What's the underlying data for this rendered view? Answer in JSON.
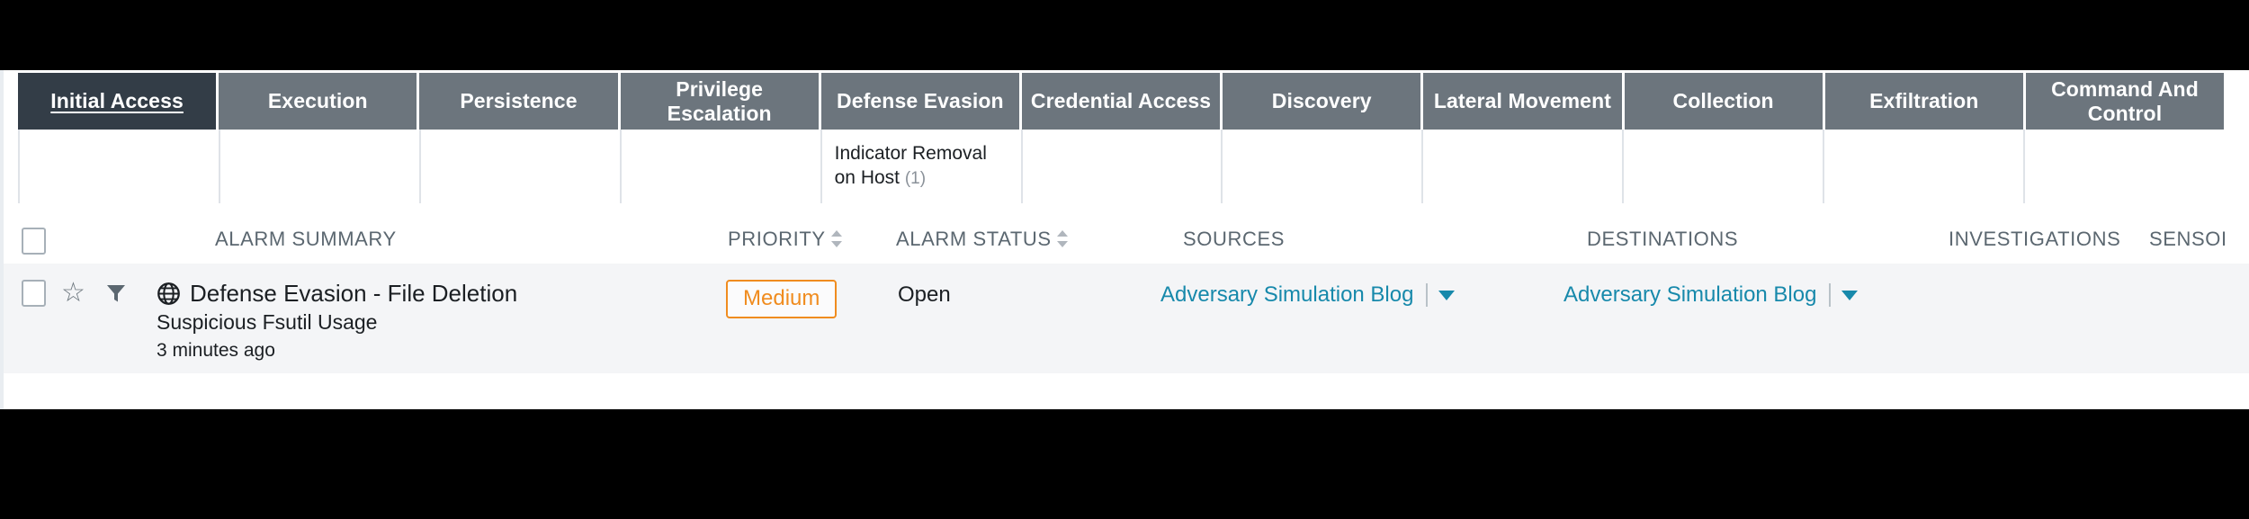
{
  "matrix": {
    "tactics": [
      {
        "label": "Initial Access",
        "selected": true
      },
      {
        "label": "Execution",
        "selected": false
      },
      {
        "label": "Persistence",
        "selected": false
      },
      {
        "label": "Privilege Escalation",
        "selected": false
      },
      {
        "label": "Defense Evasion",
        "selected": false
      },
      {
        "label": "Credential Access",
        "selected": false
      },
      {
        "label": "Discovery",
        "selected": false
      },
      {
        "label": "Lateral Movement",
        "selected": false
      },
      {
        "label": "Collection",
        "selected": false
      },
      {
        "label": "Exfiltration",
        "selected": false
      },
      {
        "label": "Command And Control",
        "selected": false
      }
    ],
    "techniques": [
      {
        "name": "",
        "count": ""
      },
      {
        "name": "",
        "count": ""
      },
      {
        "name": "",
        "count": ""
      },
      {
        "name": "",
        "count": ""
      },
      {
        "name": "Indicator Removal on Host",
        "count": "(1)"
      },
      {
        "name": "",
        "count": ""
      },
      {
        "name": "",
        "count": ""
      },
      {
        "name": "",
        "count": ""
      },
      {
        "name": "",
        "count": ""
      },
      {
        "name": "",
        "count": ""
      },
      {
        "name": "",
        "count": ""
      }
    ]
  },
  "table": {
    "headers": {
      "alarm_summary": "ALARM SUMMARY",
      "priority": "PRIORITY",
      "alarm_status": "ALARM STATUS",
      "sources": "SOURCES",
      "destinations": "DESTINATIONS",
      "investigations": "INVESTIGATIONS",
      "sensor": "SENSOI"
    },
    "rows": [
      {
        "title": "Defense Evasion - File Deletion",
        "subtitle": "Suspicious Fsutil Usage",
        "time": "3 minutes ago",
        "priority": "Medium",
        "status": "Open",
        "source": "Adversary Simulation Blog",
        "destination": "Adversary Simulation Blog",
        "investigations": "",
        "sensor": ""
      }
    ]
  },
  "colors": {
    "tactic_selected_bg": "#333d47",
    "tactic_bg": "#6c757d",
    "priority_medium": "#f08c1f",
    "link": "#1789ab",
    "row_bg": "#f4f5f7",
    "header_text": "#5b6770"
  },
  "icons": {
    "globe": "globe-icon",
    "star": "star-icon",
    "funnel": "funnel-icon",
    "sort": "sort-icon",
    "chevron_down": "chevron-down-icon",
    "checkbox": "checkbox-icon"
  }
}
